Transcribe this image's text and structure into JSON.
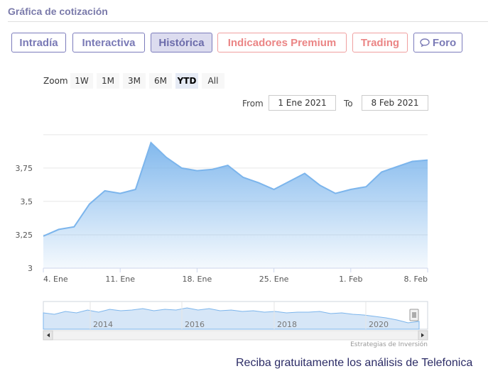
{
  "header": {
    "title": "Gráfica de cotización"
  },
  "tabs": [
    {
      "label": "Intradía",
      "style": "normal"
    },
    {
      "label": "Interactiva",
      "style": "normal"
    },
    {
      "label": "Histórica",
      "style": "active"
    },
    {
      "label": "Indicadores Premium",
      "style": "premium"
    },
    {
      "label": "Trading",
      "style": "premium"
    },
    {
      "label": "Foro",
      "style": "normal",
      "icon": "chat-bubble-icon"
    }
  ],
  "zoom": {
    "label": "Zoom",
    "buttons": [
      "1W",
      "1M",
      "3M",
      "6M",
      "YTD",
      "All"
    ],
    "selected": "YTD"
  },
  "range": {
    "from_label": "From",
    "from_value": "1 Ene 2021",
    "to_label": "To",
    "to_value": "8 Feb 2021"
  },
  "chart_data": {
    "type": "area",
    "title": "",
    "xlabel": "",
    "ylabel": "",
    "ylim": [
      3,
      4.1
    ],
    "yticks": [
      "3",
      "3,25",
      "3,5",
      "3,75"
    ],
    "xticks": [
      "4. Ene",
      "11. Ene",
      "18. Ene",
      "25. Ene",
      "1. Feb",
      "8. Feb"
    ],
    "series": [
      {
        "x": [
          "4 Ene",
          "5 Ene",
          "6 Ene",
          "7 Ene",
          "8 Ene",
          "11 Ene",
          "12 Ene",
          "13 Ene",
          "14 Ene",
          "15 Ene",
          "18 Ene",
          "19 Ene",
          "20 Ene",
          "21 Ene",
          "22 Ene",
          "25 Ene",
          "26 Ene",
          "27 Ene",
          "28 Ene",
          "29 Ene",
          "1 Feb",
          "2 Feb",
          "3 Feb",
          "4 Feb",
          "5 Feb",
          "8 Feb"
        ],
        "values": [
          3.24,
          3.29,
          3.31,
          3.48,
          3.58,
          3.56,
          3.59,
          3.94,
          3.83,
          3.75,
          3.73,
          3.74,
          3.77,
          3.68,
          3.64,
          3.59,
          3.65,
          3.71,
          3.62,
          3.56,
          3.59,
          3.61,
          3.72,
          3.76,
          3.8,
          3.81
        ]
      }
    ],
    "grid": true,
    "color": "#7cb5ec",
    "navigator": {
      "labels": [
        "2014",
        "2016",
        "2018",
        "2020"
      ]
    }
  },
  "credits": "Estrategias de Inversión",
  "cta": "Reciba gratuitamente los análisis de Telefonica"
}
